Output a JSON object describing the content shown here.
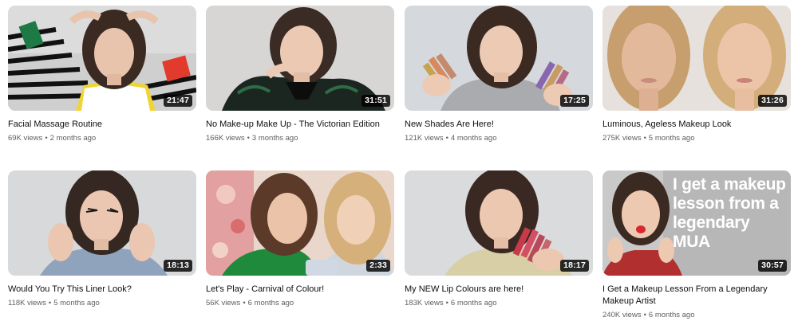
{
  "videos": [
    {
      "title": "Facial Massage Routine",
      "views": "69K views",
      "age": "2 months ago",
      "duration": "21:47"
    },
    {
      "title": "No Make-up Make Up - The Victorian Edition",
      "views": "166K views",
      "age": "3 months ago",
      "duration": "31:51"
    },
    {
      "title": "New Shades Are Here!",
      "views": "121K views",
      "age": "4 months ago",
      "duration": "17:25"
    },
    {
      "title": "Luminous, Ageless Makeup Look",
      "views": "275K views",
      "age": "5 months ago",
      "duration": "31:26"
    },
    {
      "title": "Would You Try This Liner Look?",
      "views": "118K views",
      "age": "5 months ago",
      "duration": "18:13"
    },
    {
      "title": "Let's Play - Carnival of Colour!",
      "views": "56K views",
      "age": "6 months ago",
      "duration": "2:33"
    },
    {
      "title": "My NEW Lip Colours are here!",
      "views": "183K views",
      "age": "6 months ago",
      "duration": "18:17"
    },
    {
      "title": "I Get a Makeup Lesson From a Legendary Makeup Artist",
      "views": "240K views",
      "age": "6 months ago",
      "duration": "30:57",
      "overlay_text": "I get a makeup lesson from a legendary MUA"
    }
  ],
  "separator": "•",
  "colors": {
    "title_text": "#0f0f0f",
    "meta_text": "#606060",
    "duration_bg": "#000000cc",
    "duration_text": "#ffffff"
  }
}
